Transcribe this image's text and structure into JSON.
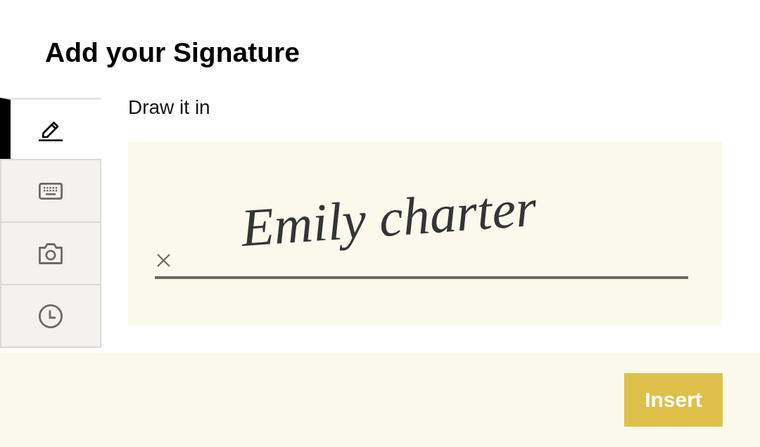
{
  "dialog": {
    "title": "Add your Signature"
  },
  "tabs": [
    {
      "kind": "draw",
      "selected": true
    },
    {
      "kind": "type",
      "selected": false
    },
    {
      "kind": "photo",
      "selected": false
    },
    {
      "kind": "recent",
      "selected": false
    }
  ],
  "panel": {
    "heading": "Draw it in",
    "signature": "Emily charter"
  },
  "footer": {
    "insert_button": "Insert"
  }
}
